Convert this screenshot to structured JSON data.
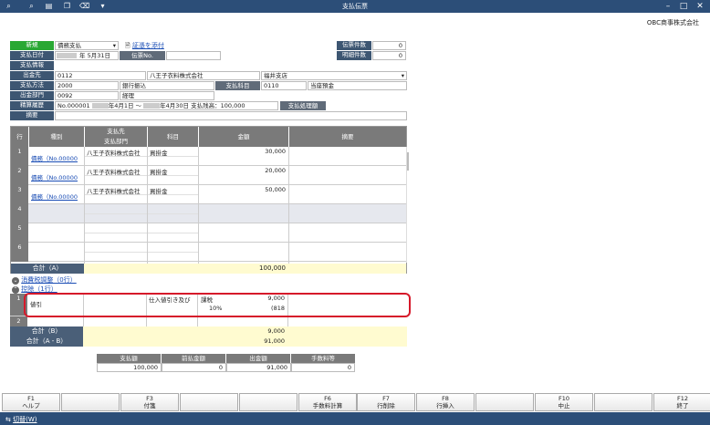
{
  "window": {
    "title": "支払伝票"
  },
  "company": "OBC商事株式会社",
  "toolbar_icons": [
    "search-plus-icon",
    "search-icon",
    "print-icon",
    "copy-icon",
    "trash-icon",
    "dropdown-icon"
  ],
  "header": {
    "new_label": "新規",
    "entry_type": "債務支払",
    "attach_link": "証憑を添付",
    "date_label": "支払日付",
    "date_value": "年  5月31日",
    "voucher_no_label": "伝票No.",
    "info_label": "支払情報",
    "payee_label": "出金先",
    "payee_code": "0112",
    "payee_name": "八王子衣料株式会社",
    "payee_branch": "福井支店",
    "method_label": "支払方法",
    "method_code": "2000",
    "method_name": "銀行振込",
    "account_btn": "支払科目",
    "account_code": "0110",
    "account_name": "当座預金",
    "dept_label": "出金部門",
    "dept_code": "0092",
    "dept_name": "経理",
    "settle_label": "精算履歴",
    "settle_value": "No.000001",
    "settle_from": "年4月1日 〜",
    "settle_to": "年4月30日",
    "settle_balance": "支払残高：100,000",
    "settle_btn": "支払処理額",
    "memo_label": "摘要",
    "count_voucher_label": "伝票件数",
    "count_voucher": "0",
    "count_detail_label": "明細件数",
    "count_detail": "0"
  },
  "grid": {
    "headers": {
      "row": "行",
      "type": "種別",
      "payee": "支払先",
      "payee_dept": "支払部門",
      "account": "科目",
      "amount": "金額",
      "memo": "摘要"
    },
    "rows": [
      {
        "no": "1",
        "type": "債務（No.00000",
        "payee": "八王子衣料株式会社",
        "account": "買掛金",
        "amount": "30,000"
      },
      {
        "no": "2",
        "type": "債務（No.00000",
        "payee": "八王子衣料株式会社",
        "account": "買掛金",
        "amount": "20,000"
      },
      {
        "no": "3",
        "type": "債務（No.00000",
        "payee": "八王子衣料株式会社",
        "account": "買掛金",
        "amount": "50,000"
      },
      {
        "no": "4",
        "type": "",
        "payee": "",
        "account": "",
        "amount": ""
      },
      {
        "no": "5",
        "type": "",
        "payee": "",
        "account": "",
        "amount": ""
      },
      {
        "no": "6",
        "type": "",
        "payee": "",
        "account": "",
        "amount": ""
      }
    ],
    "total_a_label": "合計（A）",
    "total_a": "100,000"
  },
  "tax_section": "消費税調整（0行）",
  "deduct_section": "控除（1行）",
  "deduct": {
    "rows": [
      {
        "no": "1",
        "type": "値引",
        "account": "仕入値引き及び",
        "tax_label": "課税",
        "amount": "9,000",
        "rate": "10%",
        "tax": "(818"
      },
      {
        "no": "2",
        "type": "",
        "account": "",
        "tax_label": "",
        "amount": "",
        "rate": "",
        "tax": ""
      }
    ],
    "total_b_label": "合計（B）",
    "total_b": "9,000",
    "total_ab_label": "合計（A - B）",
    "total_ab": "91,000"
  },
  "summary": {
    "headers": [
      "支払額",
      "前払金額",
      "出金額",
      "手数料等"
    ],
    "values": [
      "100,000",
      "0",
      "91,000",
      "0"
    ]
  },
  "fkeys": [
    {
      "key": "F1",
      "label": "ヘルプ"
    },
    {
      "key": "",
      "label": ""
    },
    {
      "key": "F3",
      "label": "付箋"
    },
    {
      "key": "",
      "label": ""
    },
    {
      "key": "",
      "label": ""
    },
    {
      "key": "F6",
      "label": "手数料計算"
    },
    {
      "key": "F7",
      "label": "行削除"
    },
    {
      "key": "F8",
      "label": "行挿入"
    },
    {
      "key": "",
      "label": ""
    },
    {
      "key": "F10",
      "label": "中止"
    },
    {
      "key": "",
      "label": ""
    },
    {
      "key": "F12",
      "label": "終了"
    }
  ],
  "status": {
    "switch_label": "切替(W)"
  }
}
